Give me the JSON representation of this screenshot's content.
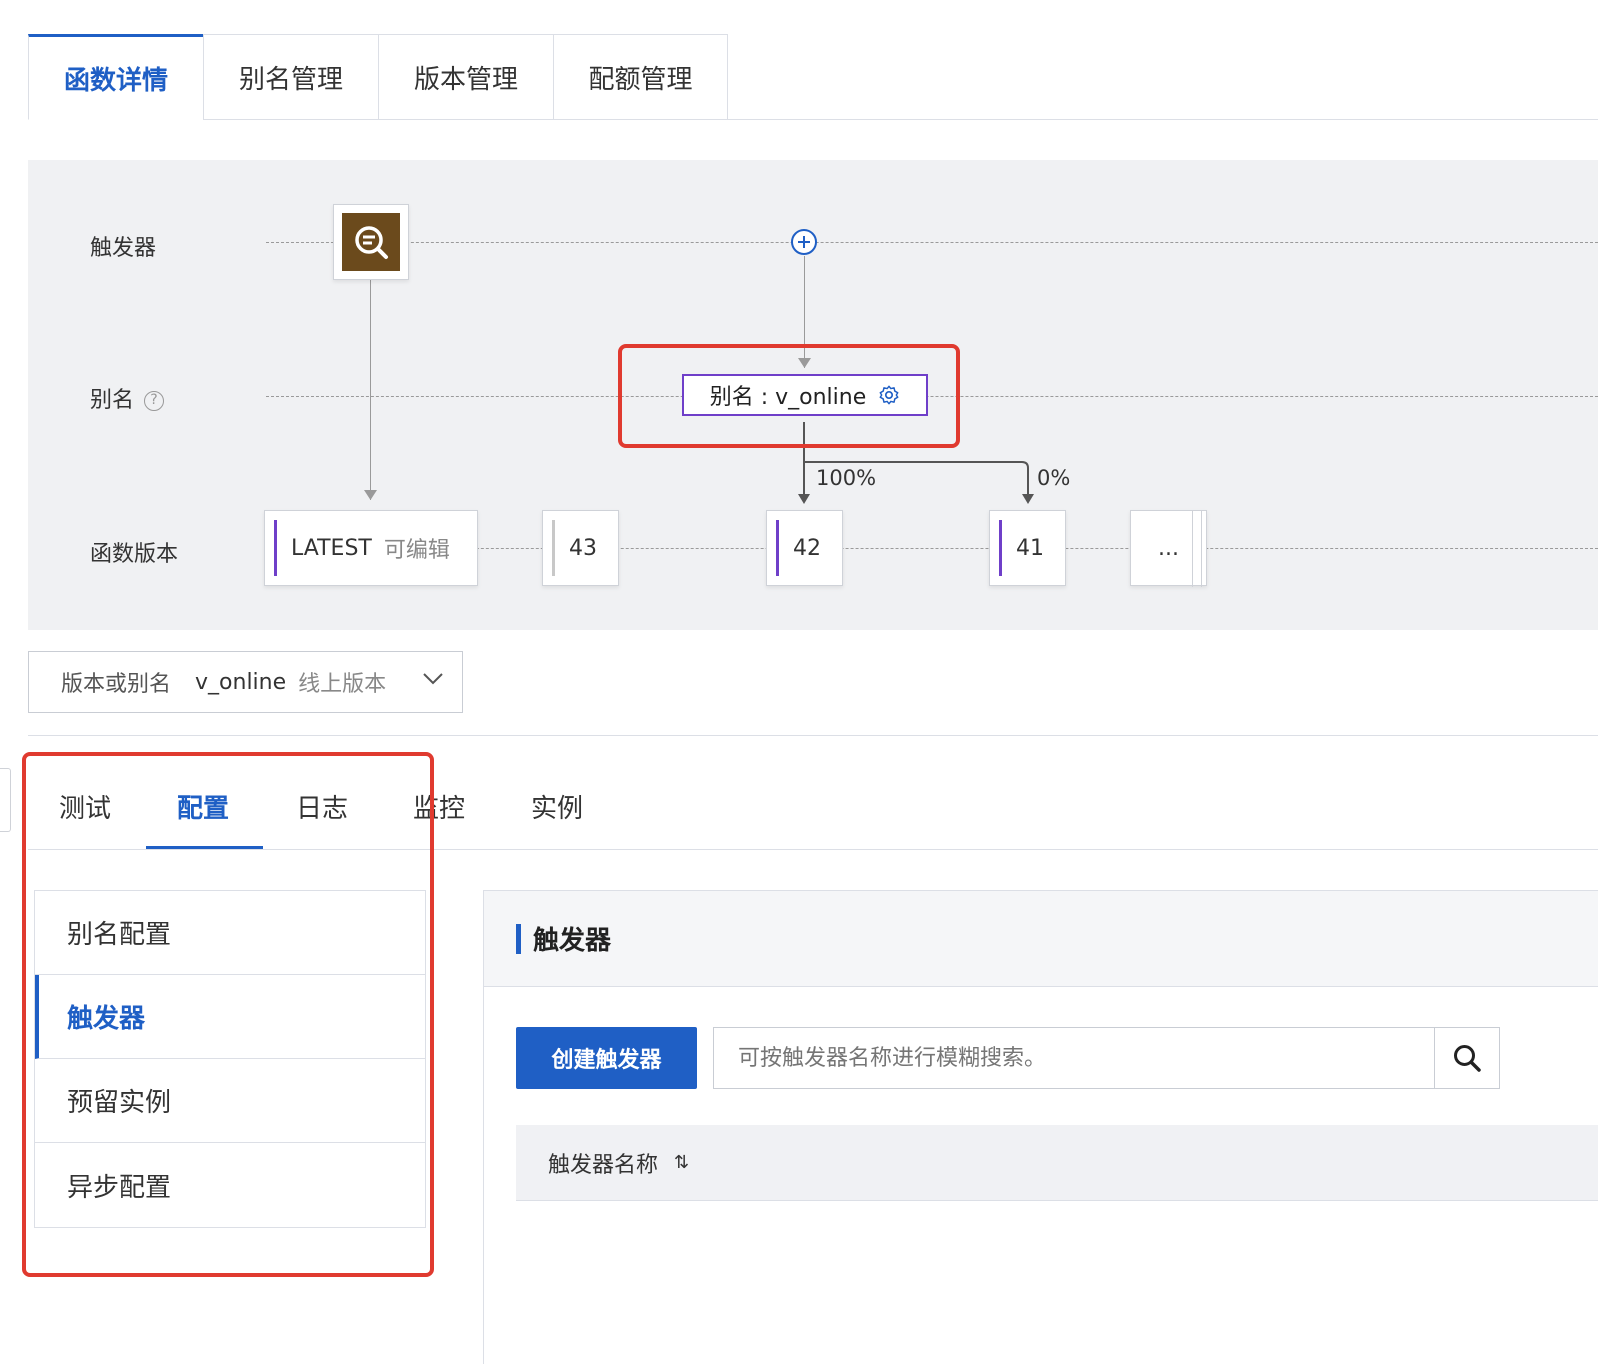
{
  "top_tabs": [
    {
      "label": "函数详情",
      "active": true
    },
    {
      "label": "别名管理",
      "active": false
    },
    {
      "label": "版本管理",
      "active": false
    },
    {
      "label": "配额管理",
      "active": false
    }
  ],
  "diagram": {
    "row_labels": {
      "trigger": "触发器",
      "alias": "别名",
      "version": "函数版本"
    },
    "alias_help": "?",
    "alias_node": "别名 : v_online",
    "traffic": {
      "primary": "100%",
      "secondary": "0%"
    },
    "versions": [
      {
        "label": "LATEST",
        "sub": "可编辑"
      },
      {
        "label": "43"
      },
      {
        "label": "42"
      },
      {
        "label": "41"
      },
      {
        "label": "..."
      }
    ]
  },
  "version_select": {
    "label": "版本或别名",
    "value": "v_online",
    "desc": "线上版本"
  },
  "sub_tabs": [
    {
      "label": "测试"
    },
    {
      "label": "配置",
      "active": true
    },
    {
      "label": "日志"
    },
    {
      "label": "监控"
    },
    {
      "label": "实例"
    }
  ],
  "menu": [
    {
      "label": "别名配置"
    },
    {
      "label": "触发器",
      "active": true
    },
    {
      "label": "预留实例"
    },
    {
      "label": "异步配置"
    }
  ],
  "panel": {
    "title": "触发器",
    "create_button": "创建触发器",
    "search_placeholder": "可按触发器名称进行模糊搜索。",
    "column_header": "触发器名称",
    "sort_glyph": "⇅"
  },
  "colors": {
    "accent": "#1f5fc5",
    "alias_border": "#6f3fc9",
    "highlight": "#e03a2f",
    "trigger_icon_bg": "#6b4a1c"
  },
  "icons": [
    "trigger-search-icon",
    "add-trigger-icon",
    "alias-settings-icon",
    "chevron-down-icon",
    "search-icon",
    "sort-icon",
    "help-icon"
  ]
}
